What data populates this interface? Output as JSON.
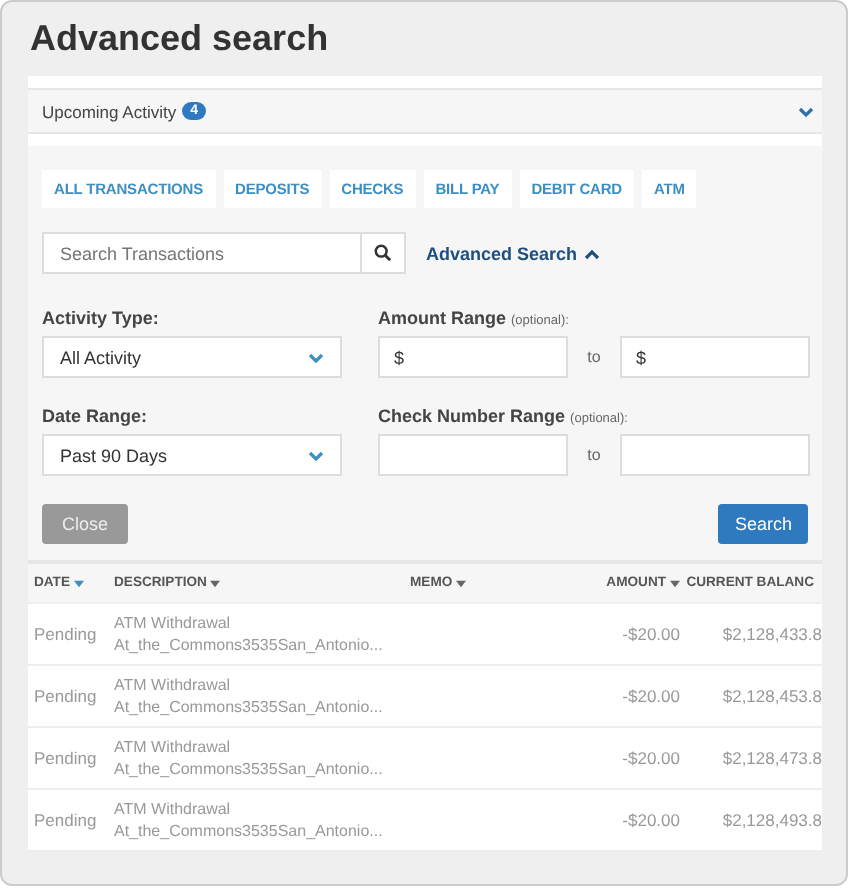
{
  "window": {
    "title": "Advanced search"
  },
  "upcoming": {
    "label": "Upcoming Activity",
    "count": "4"
  },
  "tabs": [
    "ALL TRANSACTIONS",
    "DEPOSITS",
    "CHECKS",
    "BILL PAY",
    "DEBIT CARD",
    "ATM"
  ],
  "search": {
    "placeholder": "Search Transactions",
    "advanced_link": "Advanced Search"
  },
  "form": {
    "activity_type": {
      "label": "Activity Type:",
      "value": "All Activity"
    },
    "amount_range": {
      "label": "Amount Range",
      "hint": "(optional):",
      "from": "$",
      "to_label": "to",
      "to": "$"
    },
    "date_range": {
      "label": "Date Range:",
      "value": "Past 90 Days"
    },
    "check_range": {
      "label": "Check Number Range",
      "hint": "(optional):",
      "to_label": "to"
    },
    "close_button": "Close",
    "search_button": "Search"
  },
  "table": {
    "columns": [
      {
        "label": "DATE",
        "sorted": true
      },
      {
        "label": "DESCRIPTION",
        "sorted": false
      },
      {
        "label": "MEMO",
        "sorted": false
      },
      {
        "label": "AMOUNT",
        "sorted": false
      },
      {
        "label": "CURRENT BALANC",
        "sorted": false
      }
    ],
    "rows": [
      {
        "date": "Pending",
        "description": "ATM Withdrawal",
        "detail": "At_the_Commons3535San_Antonio...",
        "amount": "-$20.00",
        "balance": "$2,128,433.8"
      },
      {
        "date": "Pending",
        "description": "ATM Withdrawal",
        "detail": "At_the_Commons3535San_Antonio...",
        "amount": "-$20.00",
        "balance": "$2,128,453.8"
      },
      {
        "date": "Pending",
        "description": "ATM Withdrawal",
        "detail": "At_the_Commons3535San_Antonio...",
        "amount": "-$20.00",
        "balance": "$2,128,473.8"
      },
      {
        "date": "Pending",
        "description": "ATM Withdrawal",
        "detail": "At_the_Commons3535San_Antonio...",
        "amount": "-$20.00",
        "balance": "$2,128,493.8"
      }
    ]
  }
}
